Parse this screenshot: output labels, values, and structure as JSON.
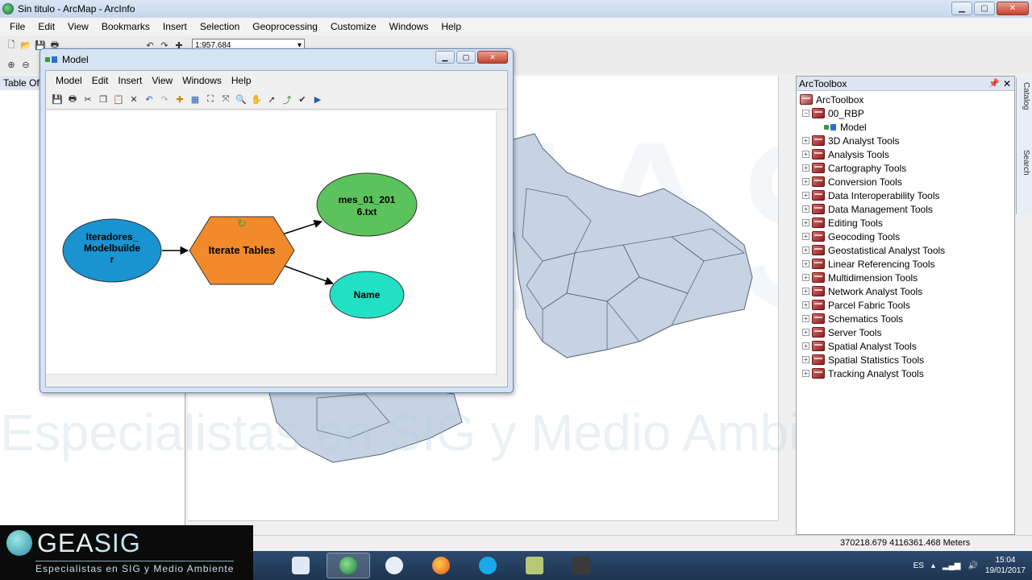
{
  "window": {
    "title": "Sin titulo - ArcMap - ArcInfo"
  },
  "menubar": [
    "File",
    "Edit",
    "View",
    "Bookmarks",
    "Insert",
    "Selection",
    "Geoprocessing",
    "Customize",
    "Windows",
    "Help"
  ],
  "toolbar": {
    "scale": "1:957.684"
  },
  "toc": {
    "title": "Table Of"
  },
  "model_window": {
    "title": "Model",
    "menu": [
      "Model",
      "Edit",
      "Insert",
      "View",
      "Windows",
      "Help"
    ],
    "nodes": {
      "input": [
        "Iteradores_",
        "Modelbuilde",
        "r"
      ],
      "tool": "Iterate Tables",
      "output1": [
        "mes_01_201",
        "6.txt"
      ],
      "output2": "Name"
    }
  },
  "toolbox": {
    "title": "ArcToolbox",
    "root": "ArcToolbox",
    "items": [
      {
        "label": "00_RBP",
        "level": 1,
        "expanded": true
      },
      {
        "label": "Model",
        "level": 2,
        "type": "model"
      },
      {
        "label": "3D Analyst Tools",
        "level": 1
      },
      {
        "label": "Analysis Tools",
        "level": 1
      },
      {
        "label": "Cartography Tools",
        "level": 1
      },
      {
        "label": "Conversion Tools",
        "level": 1
      },
      {
        "label": "Data Interoperability Tools",
        "level": 1
      },
      {
        "label": "Data Management Tools",
        "level": 1
      },
      {
        "label": "Editing Tools",
        "level": 1
      },
      {
        "label": "Geocoding Tools",
        "level": 1
      },
      {
        "label": "Geostatistical Analyst Tools",
        "level": 1
      },
      {
        "label": "Linear Referencing Tools",
        "level": 1
      },
      {
        "label": "Multidimension Tools",
        "level": 1
      },
      {
        "label": "Network Analyst Tools",
        "level": 1
      },
      {
        "label": "Parcel Fabric Tools",
        "level": 1
      },
      {
        "label": "Schematics Tools",
        "level": 1
      },
      {
        "label": "Server Tools",
        "level": 1
      },
      {
        "label": "Spatial Analyst Tools",
        "level": 1
      },
      {
        "label": "Spatial Statistics Tools",
        "level": 1
      },
      {
        "label": "Tracking Analyst Tools",
        "level": 1
      }
    ]
  },
  "side_tabs": [
    "Catalog",
    "Search"
  ],
  "status": {
    "coords": "370218.679  4116361.468 Meters"
  },
  "taskbar": {
    "lang": "ES",
    "time": "15:04",
    "date": "19/01/2017"
  },
  "brand": {
    "name_a": "GEA",
    "name_b": "SIG",
    "tagline": "Especialistas en SIG y Medio Ambiente"
  },
  "watermark": "Especialistas en SIG y Medio Ambiente",
  "colors": {
    "input": "#1a93d1",
    "tool": "#f08a2a",
    "output1": "#5cc35c",
    "output2": "#22e0c4"
  }
}
